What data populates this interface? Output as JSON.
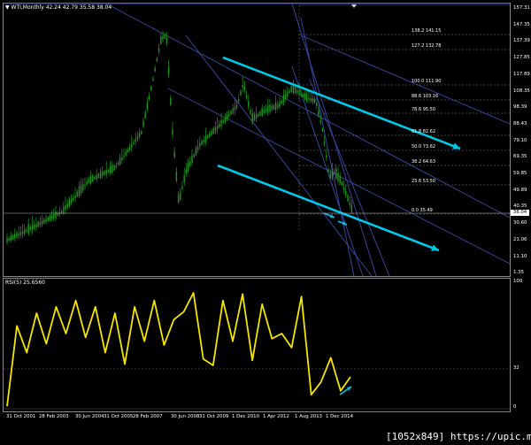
{
  "header": {
    "symbol_line": "▼ WTI,Monthly  42.24 42.79 35.58 38.04",
    "rsi_title": "RSI(5) 25.6560"
  },
  "price_axis": {
    "labels": [
      "157.31",
      "147.35",
      "137.39",
      "127.85",
      "117.89",
      "108.35",
      "98.39",
      "88.43",
      "79.10",
      "69.35",
      "59.85",
      "49.89",
      "40.35",
      "30.60",
      "21.06",
      "11.10",
      "1.35"
    ],
    "last_price": "38.04"
  },
  "fibonacci_levels": [
    {
      "label": "138.2  141.15"
    },
    {
      "label": "127.2  132.78"
    },
    {
      "label": "100.0  111.90"
    },
    {
      "label": "88.6  103.16"
    },
    {
      "label": "78.6  95.50"
    },
    {
      "label": "61.8  82.62"
    },
    {
      "label": "50.0  73.62"
    },
    {
      "label": "38.2  64.63"
    },
    {
      "label": "23.6  53.50"
    },
    {
      "label": "0.0  35.49"
    }
  ],
  "rsi_axis": {
    "labels": [
      "100",
      "32",
      "0"
    ]
  },
  "time_axis": {
    "labels": [
      "31 Oct 2001",
      "28 Feb 2003",
      "30 Jun 2004",
      "31 Oct 2005",
      "28 Feb 2007",
      "30 Jun 2008",
      "31 Oct 2009",
      "1 Dec 2010",
      "1 Apr 2012",
      "1 Aug 2013",
      "1 Dec 2014"
    ]
  },
  "watermark": "[1052x849] https://upic.me/",
  "colors": {
    "candles": "#1e9b1e",
    "trendlines": "#3a4aa8",
    "channel_arrows": "#00c8e6",
    "rsi_line": "#f5e600",
    "fib_levels": "#808080",
    "background": "#000000"
  },
  "chart_data": [
    {
      "type": "line",
      "title": "WTI,Monthly",
      "x": [
        "31 Oct 2001",
        "28 Feb 2003",
        "30 Jun 2004",
        "31 Oct 2005",
        "28 Feb 2007",
        "30 Jun 2008",
        "31 Oct 2009",
        "1 Dec 2010",
        "1 Apr 2012",
        "1 Aug 2013",
        "1 Dec 2014"
      ],
      "series": [
        {
          "name": "WTI,Monthly",
          "values": [
            22,
            35,
            40,
            60,
            60,
            140,
            78,
            92,
            104,
            107,
            55
          ]
        }
      ],
      "ylim": [
        1.35,
        157.31
      ]
    },
    {
      "type": "line",
      "title": "RSI(5) 25.6560",
      "series": [
        {
          "name": "RSI(5) 25.6560",
          "values": [
            2,
            65,
            44,
            75,
            51,
            80,
            59,
            85,
            56,
            80,
            44,
            75,
            35,
            80,
            53,
            85,
            50,
            70,
            76,
            91,
            39,
            34,
            85,
            53,
            90,
            38,
            82,
            55,
            59,
            48,
            88,
            11,
            21,
            40,
            14,
            25
          ]
        }
      ],
      "ylim": [
        0,
        100
      ]
    }
  ]
}
